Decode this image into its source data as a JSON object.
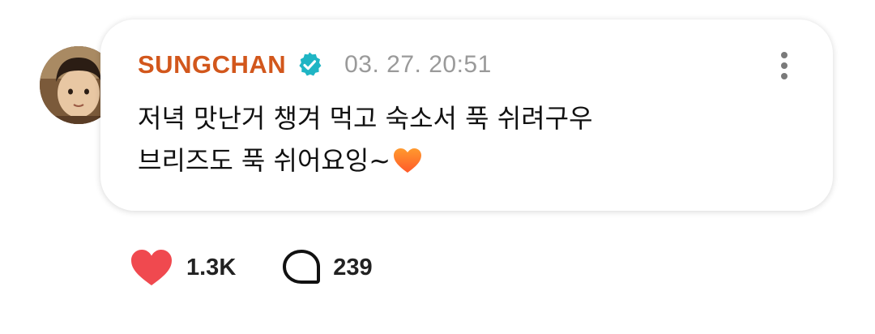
{
  "post": {
    "author": "SUNGCHAN",
    "verified": true,
    "timestamp": "03. 27. 20:51",
    "message_lines": [
      "저녁 맛난거 챙겨 먹고 숙소서 푹 쉬려구우",
      "브리즈도 푹 쉬어요잉~"
    ],
    "emoji": "orange-heart"
  },
  "reactions": {
    "likes": "1.3K",
    "comments": "239"
  },
  "icons": {
    "avatar": "avatar",
    "verified": "verified-badge-icon",
    "more": "more-vertical-icon",
    "like": "heart-icon",
    "comment": "comment-bubble-icon"
  },
  "colors": {
    "author": "#d2571c",
    "verified_badge": "#1fb5c4",
    "timestamp": "#9a9a9a",
    "like": "#f0494f",
    "text": "#111111"
  }
}
